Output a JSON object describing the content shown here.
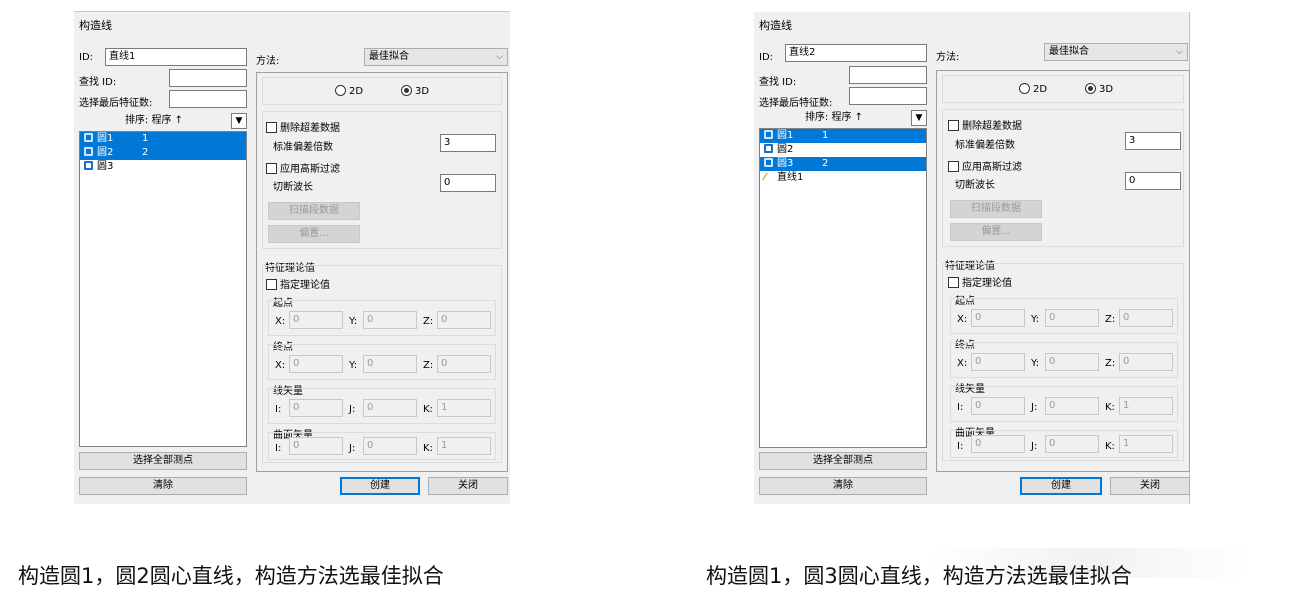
{
  "common": {
    "title": "构造线",
    "id_label": "ID:",
    "find_id_label": "查找 ID:",
    "select_last_label": "选择最后特征数:",
    "sort_label": "排序: 程序 ↑",
    "sort_arrow": "▼",
    "method_label": "方法:",
    "method_value": "最佳拟合",
    "combo_arrow": "⌵",
    "radio_2d": "2D",
    "radio_3d": "3D",
    "delete_outliers": "删除超差数据",
    "std_dev_label": "标准偏差倍数",
    "std_dev_value": "3",
    "gauss_filter": "应用高斯过滤",
    "cutoff_label": "切断波长",
    "cutoff_value": "0",
    "scan_btn": "扫描段数据",
    "offset_btn": "偏置...",
    "theo_group": "特征理论值",
    "specify_theo": "指定理论值",
    "start_group": "起点",
    "end_group": "终点",
    "line_vec_group": "线矢量",
    "surf_vec_group": "曲面矢量",
    "x_label": "X:",
    "y_label": "Y:",
    "z_label": "Z:",
    "i_label": "I:",
    "j_label": "J:",
    "k_label": "K:",
    "zero": "0",
    "one": "1",
    "select_all_btn": "选择全部测点",
    "clear_btn": "清除",
    "create_btn": "创建",
    "close_btn": "关闭"
  },
  "dialogs": [
    {
      "id_value": "直线1",
      "list": [
        {
          "label": "圆1",
          "num": "1",
          "selected": true,
          "icon": "circle-icon"
        },
        {
          "label": "圆2",
          "num": "2",
          "selected": true,
          "icon": "circle-icon"
        },
        {
          "label": "圆3",
          "num": "",
          "selected": false,
          "icon": "circle-icon"
        }
      ],
      "caption": "构造圆1，圆2圆心直线，构造方法选最佳拟合"
    },
    {
      "id_value": "直线2",
      "list": [
        {
          "label": "圆1",
          "num": "1",
          "selected": true,
          "icon": "circle-icon"
        },
        {
          "label": "圆2",
          "num": "",
          "selected": false,
          "icon": "circle-icon"
        },
        {
          "label": "圆3",
          "num": "2",
          "selected": true,
          "icon": "circle-icon"
        },
        {
          "label": "直线1",
          "num": "",
          "selected": false,
          "icon": "line-icon"
        }
      ],
      "caption": "构造圆1，圆3圆心直线，构造方法选最佳拟合"
    }
  ]
}
